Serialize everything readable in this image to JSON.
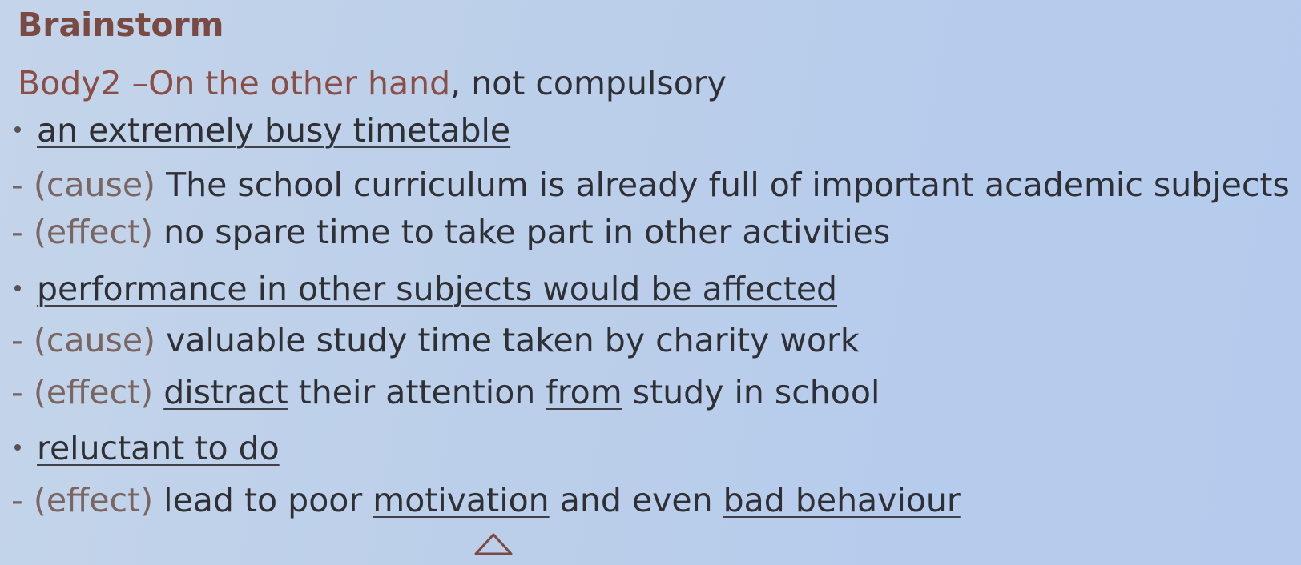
{
  "slide": {
    "title": "Brainstorm",
    "heading": {
      "prefix": "Body2 –",
      "highlight": "On the other hand",
      "suffix": ", not compulsory"
    },
    "points": [
      {
        "bullet": "an extremely busy timetable",
        "details": [
          {
            "tag": "- (cause)",
            "text": " The school curriculum is already full of important academic subjects"
          },
          {
            "tag": "- (effect)",
            "text": " no spare time to take part in other activities"
          }
        ]
      },
      {
        "bullet": "performance in other subjects would be affected",
        "details": [
          {
            "tag": "- (cause)",
            "text": " valuable study time taken by charity work"
          },
          {
            "tag": "- (effect)",
            "parts": [
              " ",
              "distract",
              " their attention ",
              "from",
              " study in school"
            ]
          }
        ]
      },
      {
        "bullet": "reluctant to do",
        "details": [
          {
            "tag": "- (effect)",
            "parts": [
              " lead to poor ",
              "motivation",
              " and even ",
              "bad behaviour"
            ]
          }
        ]
      }
    ]
  },
  "colors": {
    "background": "#bccfea",
    "title": "#7a4a42",
    "body_text": "#2f3036",
    "tag_text": "#7a6560"
  }
}
